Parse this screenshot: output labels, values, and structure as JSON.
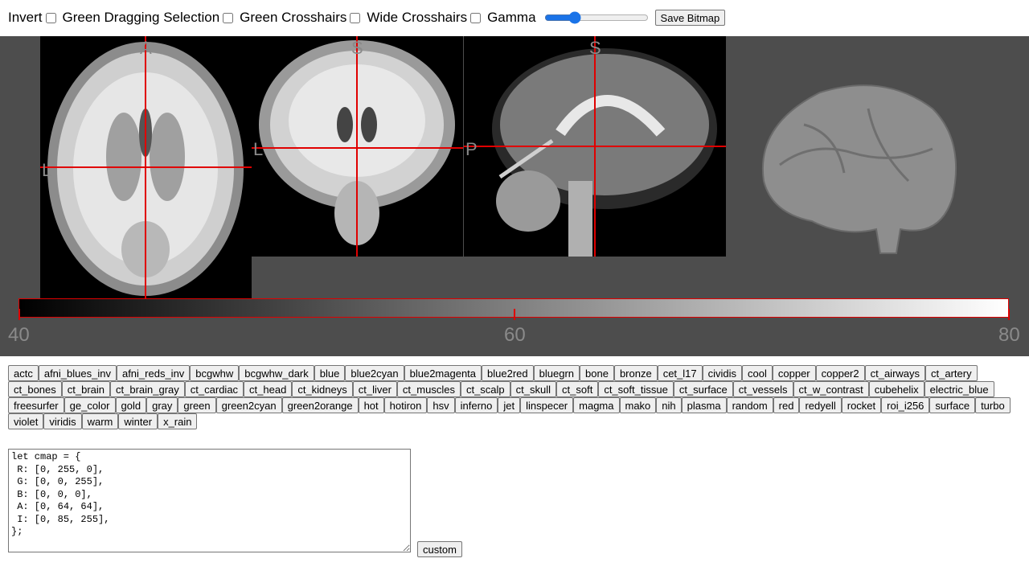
{
  "toolbar": {
    "invert_label": "Invert",
    "green_drag_label": "Green Dragging Selection",
    "green_crosshair_label": "Green Crosshairs",
    "wide_crosshair_label": "Wide Crosshairs",
    "gamma_label": "Gamma",
    "gamma_value": 0.27,
    "save_label": "Save Bitmap"
  },
  "viewer": {
    "axial": {
      "top": "A",
      "left": "L"
    },
    "coronal": {
      "top": "S",
      "left": "L"
    },
    "sagittal": {
      "top": "S",
      "left": "P"
    },
    "colorbar": {
      "min": "40",
      "mid": "60",
      "max": "80"
    }
  },
  "colormaps": [
    "actc",
    "afni_blues_inv",
    "afni_reds_inv",
    "bcgwhw",
    "bcgwhw_dark",
    "blue",
    "blue2cyan",
    "blue2magenta",
    "blue2red",
    "bluegrn",
    "bone",
    "bronze",
    "cet_l17",
    "cividis",
    "cool",
    "copper",
    "copper2",
    "ct_airways",
    "ct_artery",
    "ct_bones",
    "ct_brain",
    "ct_brain_gray",
    "ct_cardiac",
    "ct_head",
    "ct_kidneys",
    "ct_liver",
    "ct_muscles",
    "ct_scalp",
    "ct_skull",
    "ct_soft",
    "ct_soft_tissue",
    "ct_surface",
    "ct_vessels",
    "ct_w_contrast",
    "cubehelix",
    "electric_blue",
    "freesurfer",
    "ge_color",
    "gold",
    "gray",
    "green",
    "green2cyan",
    "green2orange",
    "hot",
    "hotiron",
    "hsv",
    "inferno",
    "jet",
    "linspecer",
    "magma",
    "mako",
    "nih",
    "plasma",
    "random",
    "red",
    "redyell",
    "rocket",
    "roi_i256",
    "surface",
    "turbo",
    "violet",
    "viridis",
    "warm",
    "winter",
    "x_rain"
  ],
  "editor": {
    "text": "let cmap = {\n R: [0, 255, 0],\n G: [0, 0, 255],\n B: [0, 0, 0],\n A: [0, 64, 64],\n I: [0, 85, 255],\n};",
    "custom_label": "custom"
  }
}
